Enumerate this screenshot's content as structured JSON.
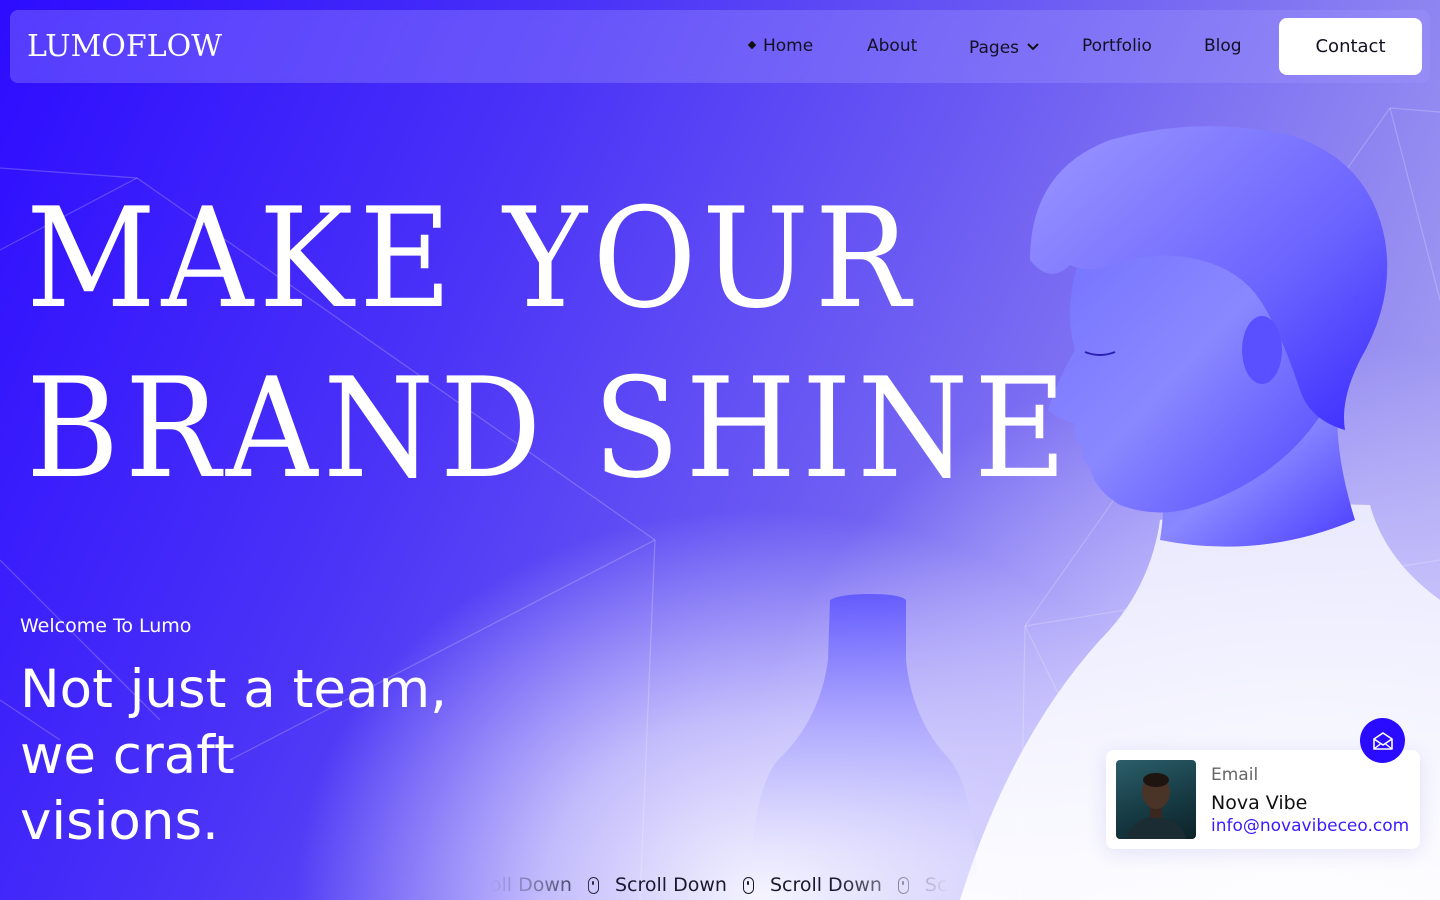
{
  "brand": {
    "logo": "LUMOFLOW"
  },
  "nav": {
    "items": [
      {
        "label": "Home",
        "active": true
      },
      {
        "label": "About"
      },
      {
        "label": "Pages",
        "has_dropdown": true
      },
      {
        "label": "Portfolio"
      },
      {
        "label": "Blog"
      }
    ],
    "cta": "Contact"
  },
  "hero": {
    "headline_line1": "MAKE YOUR",
    "headline_line2": "BRAND SHINE",
    "welcome": "Welcome To Lumo",
    "tagline_line1": "Not just a team,",
    "tagline_line2": "we craft",
    "tagline_line3": "visions."
  },
  "scroll_indicator": {
    "label": "Scroll Down"
  },
  "contact_card": {
    "label": "Email",
    "name": "Nova Vibe",
    "email": "info@novavibeceo.com"
  },
  "colors": {
    "accent": "#2a0bff",
    "text_light": "#ffffff",
    "text_dark": "#111122"
  },
  "icons": {
    "nav_active": "diamond-icon",
    "pages_dropdown": "chevron-down-icon",
    "scroll": "mouse-icon",
    "email_fab": "envelope-open-icon"
  }
}
